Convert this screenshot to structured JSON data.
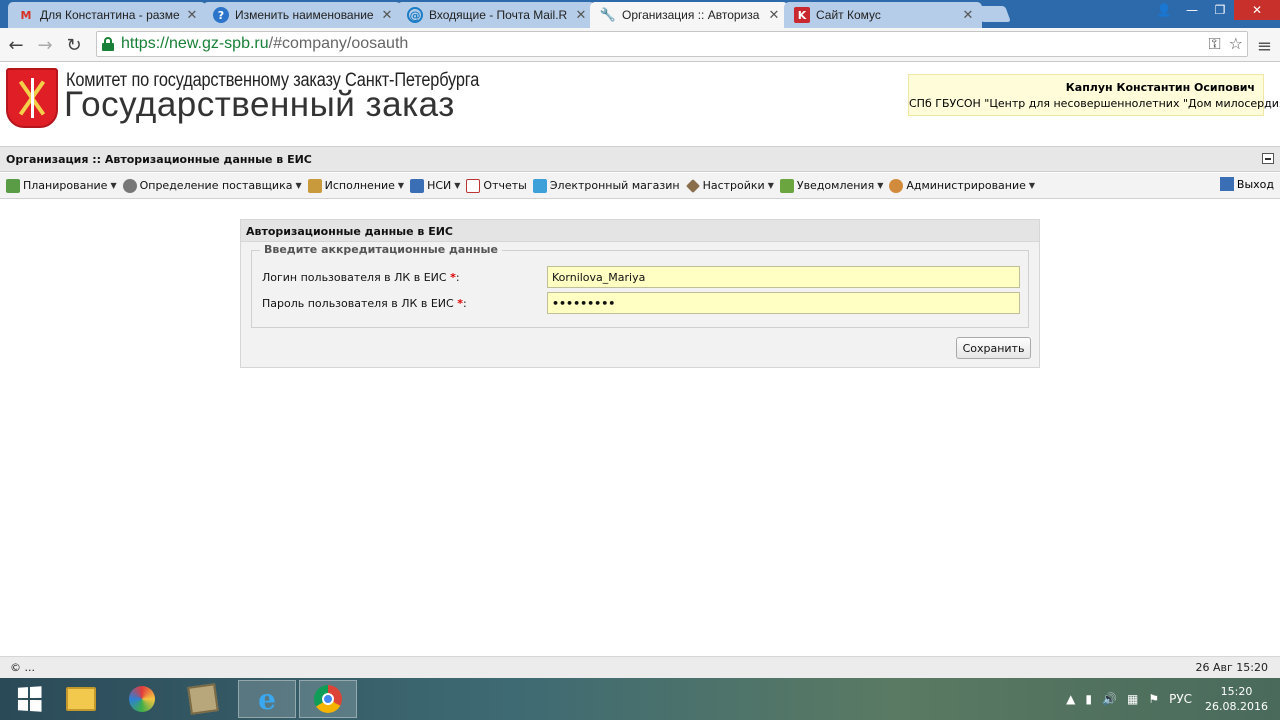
{
  "browser": {
    "tabs": [
      {
        "title": "Для Константина - разме",
        "icon": "gmail-icon",
        "active": false
      },
      {
        "title": "Изменить наименование",
        "icon": "help-icon",
        "active": false
      },
      {
        "title": "Входящие - Почта Mail.R",
        "icon": "mail-ru-icon",
        "active": false
      },
      {
        "title": "Организация :: Авториза",
        "icon": "wrench-icon",
        "active": true
      },
      {
        "title": "Сайт Комус",
        "icon": "komus-icon",
        "active": false
      }
    ],
    "url_host": "https://new.gz-spb.ru",
    "url_rest": "/#company/oosauth"
  },
  "header": {
    "org_name": "Комитет по государственному заказу Санкт-Петербурга",
    "brand": "Государственный заказ",
    "user_name": "Каплун Константин Осипович",
    "user_org": "СПб ГБУСОН \"Центр для несовершеннолетних \"Дом милосердия\""
  },
  "page_title": "Организация :: Авторизационные данные в ЕИС",
  "menu": {
    "items": [
      {
        "label": "Планирование",
        "dropdown": true
      },
      {
        "label": "Определение поставщика",
        "dropdown": true
      },
      {
        "label": "Исполнение",
        "dropdown": true
      },
      {
        "label": "НСИ",
        "dropdown": true
      },
      {
        "label": "Отчеты",
        "dropdown": false
      },
      {
        "label": "Электронный магазин",
        "dropdown": false
      },
      {
        "label": "Настройки",
        "dropdown": true
      },
      {
        "label": "Уведомления",
        "dropdown": true
      },
      {
        "label": "Администрирование",
        "dropdown": true
      }
    ],
    "logout": "Выход"
  },
  "form": {
    "title": "Авторизационные данные в ЕИС",
    "legend": "Введите аккредитационные данные",
    "login_label": "Логин пользователя в ЛК в ЕИС",
    "login_value": "Kornilova_Mariya",
    "password_label": "Пароль пользователя в ЛК в ЕИС",
    "password_value": "•••••••••",
    "required_mark": "*",
    "label_suffix": ":",
    "save_label": "Сохранить"
  },
  "footer": {
    "copyright": "© ...",
    "timestamp": "26 Авг 15:20"
  },
  "taskbar": {
    "lang": "РУС",
    "time": "15:20",
    "date": "26.08.2016"
  },
  "colors": {
    "accent": "#2d6aab",
    "field_bg": "#ffffc3",
    "required": "#dd0000"
  }
}
